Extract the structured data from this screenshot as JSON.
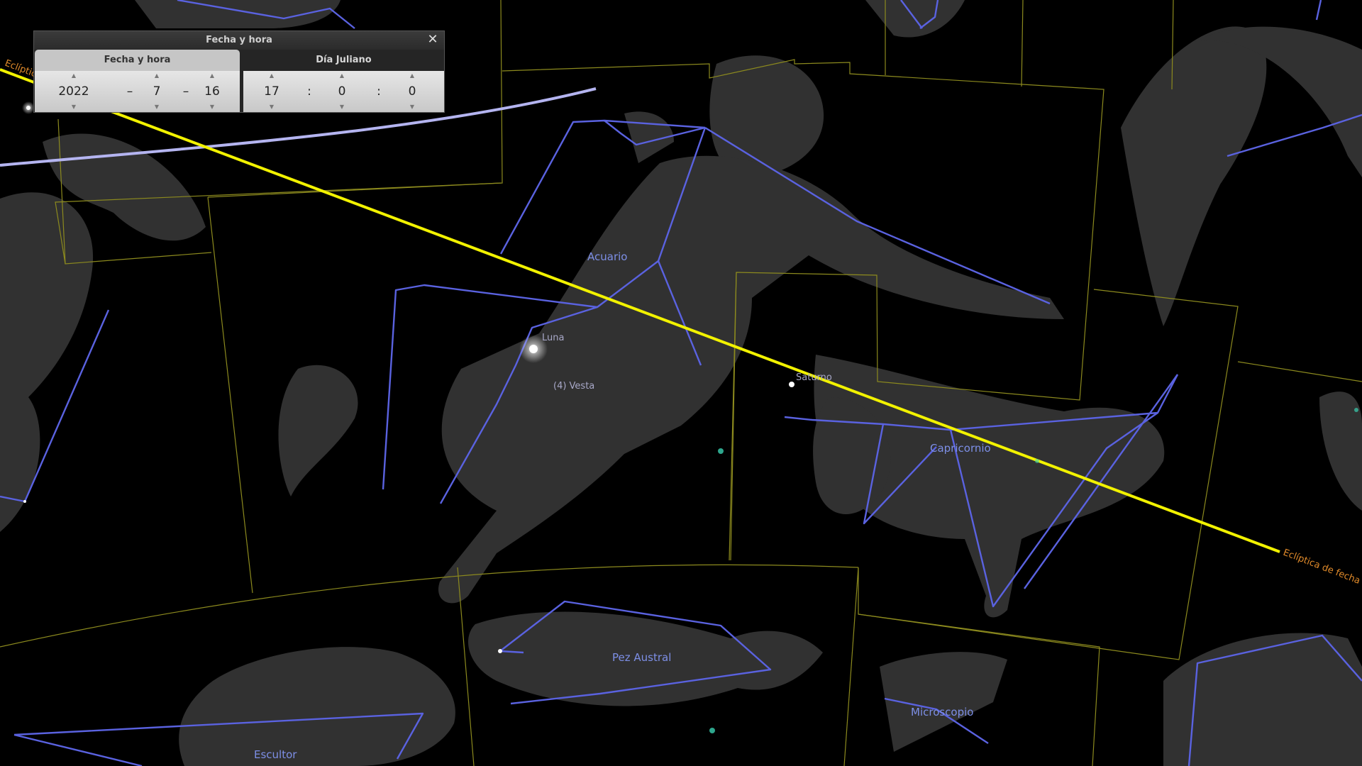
{
  "dialog": {
    "title": "Fecha y hora",
    "close_glyph": "✕",
    "tabs": [
      {
        "label": "Fecha y hora",
        "active": true
      },
      {
        "label": "Día Juliano",
        "active": false
      }
    ],
    "date": {
      "year": "2022",
      "month": "7",
      "day": "16",
      "separator": "–"
    },
    "time": {
      "hour": "17",
      "minute": "0",
      "second": "0",
      "separator": ":"
    },
    "spin_up_glyph": "▲",
    "spin_down_glyph": "▼"
  },
  "sky": {
    "constellations": [
      "Acuario",
      "Capricornio",
      "Pez Austral",
      "Microscopio",
      "Escultor"
    ],
    "bodies": [
      "Luna",
      "(4) Vesta",
      "Saturno"
    ],
    "ecliptic_label_right": "Eclíptica de fecha",
    "ecliptic_label_left": "Eclíptica de fe",
    "colors": {
      "constellation_lines": "#5a62e0",
      "ecliptic": "#f2f200",
      "boundaries": "#8c8a1e",
      "equator": "#b4b4f0",
      "constellation_label": "#7d8fe6",
      "ecliptic_label": "#e08a2a"
    }
  }
}
